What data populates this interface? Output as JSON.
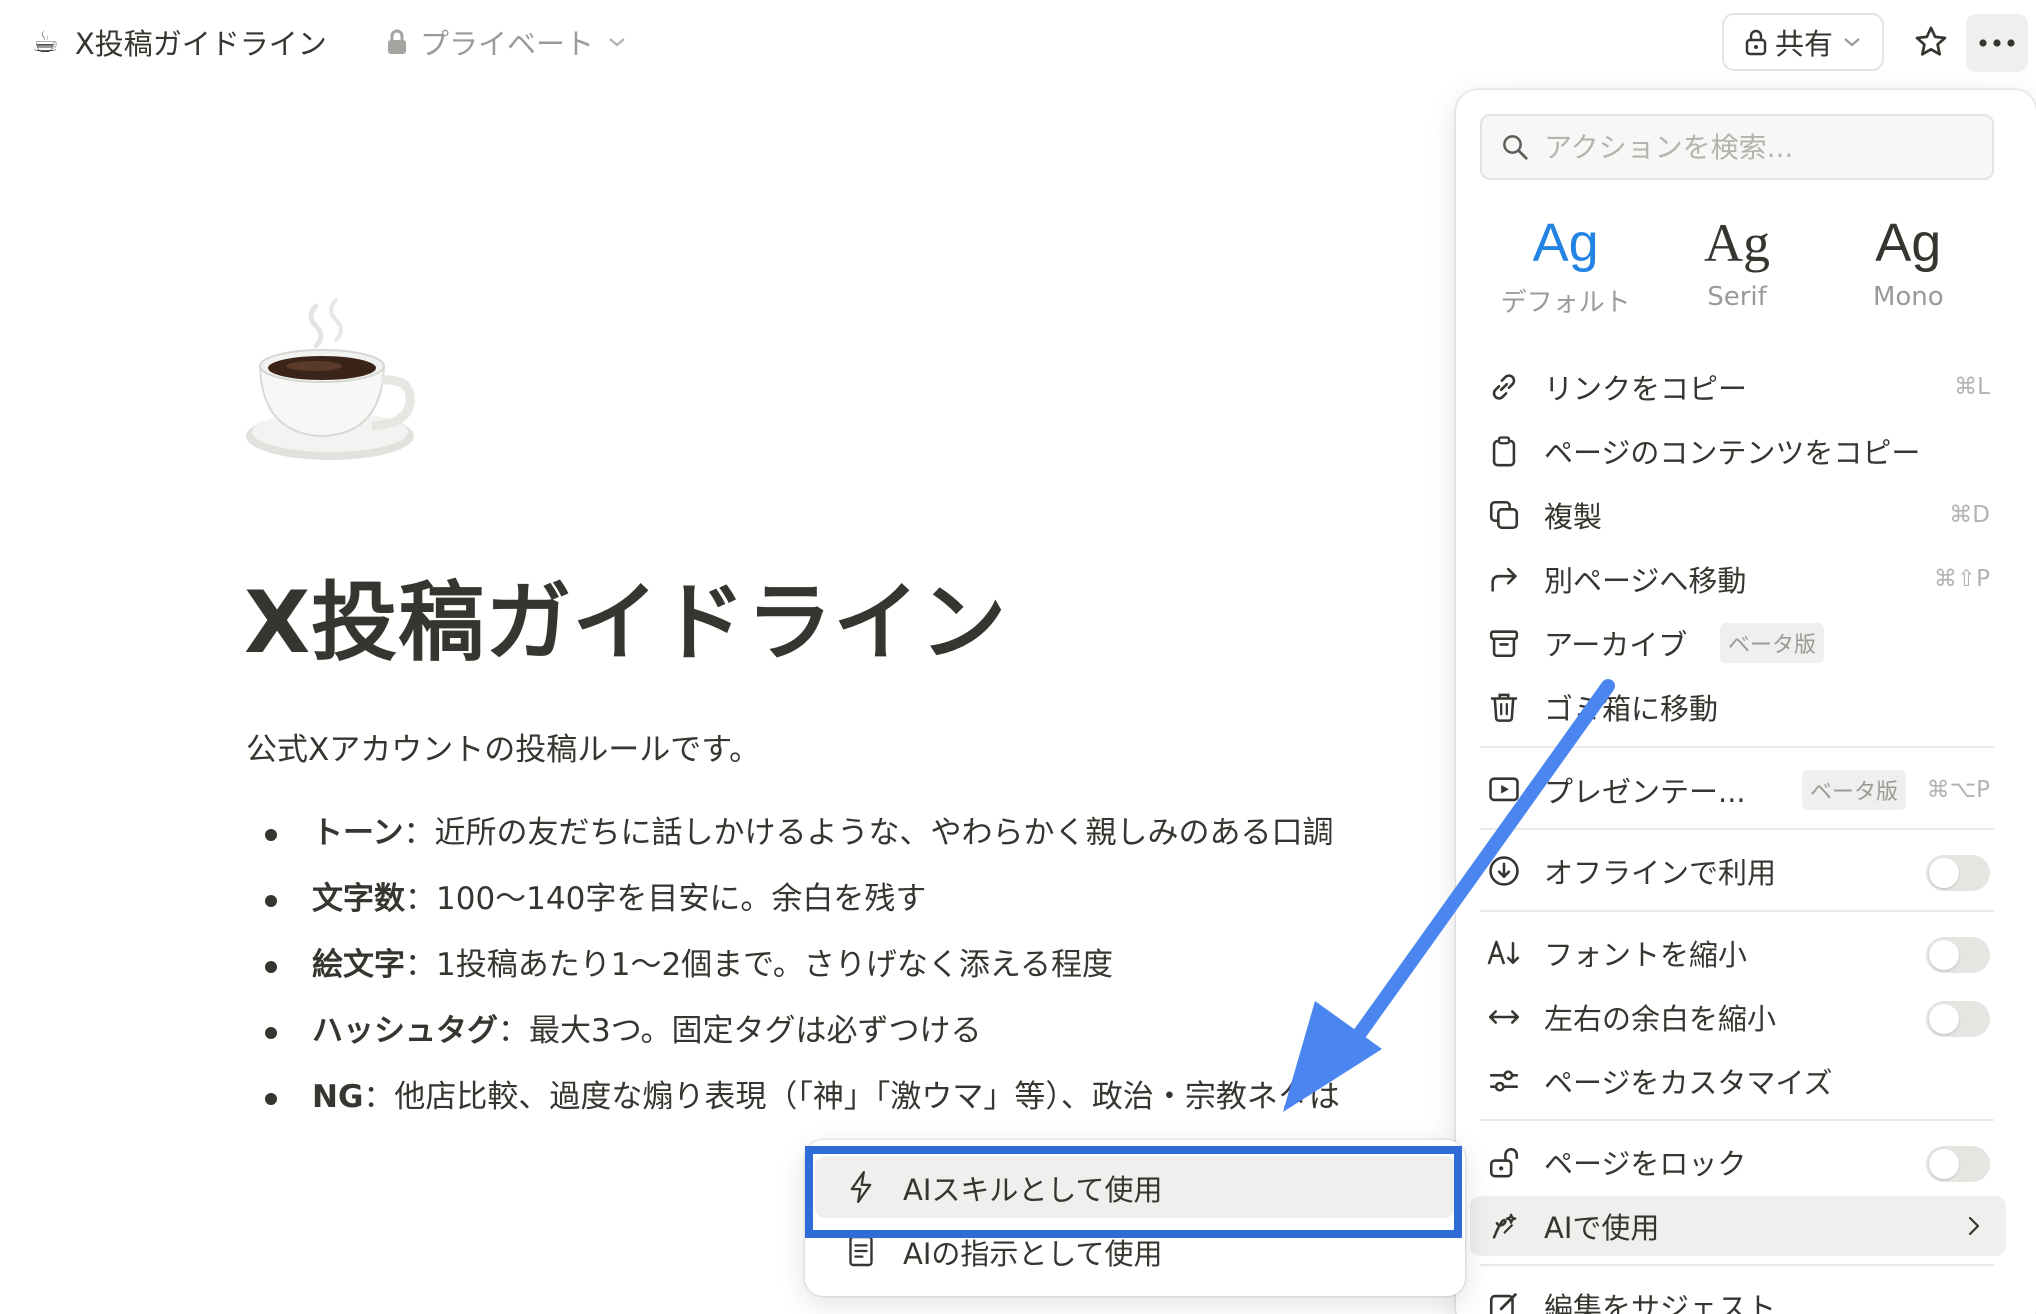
{
  "topbar": {
    "page_emoji": "☕",
    "page_title": "X投稿ガイドライン",
    "privacy_label": "プライベート",
    "share_label": "共有"
  },
  "page": {
    "title": "X投稿ガイドライン",
    "intro": "公式Xアカウントの投稿ルールです。",
    "bullets": [
      {
        "term": "トーン",
        "text": "：近所の友だちに話しかけるような、やわらかく親しみのある口調"
      },
      {
        "term": "文字数",
        "text": "：100〜140字を目安に。余白を残す"
      },
      {
        "term": "絵文字",
        "text": "：1投稿あたり1〜2個まで。さりげなく添える程度"
      },
      {
        "term": "ハッシュタグ",
        "text": "：最大3つ。固定タグは必ずつける"
      },
      {
        "term": "NG",
        "text": "：他店比較、過度な煽り表現（「神」「激ウマ」等）、政治・宗教ネタは"
      }
    ]
  },
  "menu": {
    "search_placeholder": "アクションを検索...",
    "fonts": [
      {
        "sample": "Ag",
        "label": "デフォルト",
        "active": true
      },
      {
        "sample": "Ag",
        "label": "Serif",
        "active": false
      },
      {
        "sample": "Ag",
        "label": "Mono",
        "active": false
      }
    ],
    "items": {
      "copy_link": {
        "label": "リンクをコピー",
        "shortcut": "⌘L",
        "icon": "link-icon"
      },
      "copy_contents": {
        "label": "ページのコンテンツをコピー",
        "icon": "clipboard-icon"
      },
      "duplicate": {
        "label": "複製",
        "shortcut": "⌘D",
        "icon": "duplicate-icon"
      },
      "move_to": {
        "label": "別ページへ移動",
        "shortcut": "⌘⇧P",
        "icon": "move-arrow-icon"
      },
      "archive": {
        "label": "アーカイブ",
        "badge": "ベータ版",
        "icon": "archive-icon"
      },
      "trash": {
        "label": "ゴミ箱に移動",
        "icon": "trash-icon"
      },
      "present": {
        "label": "プレゼンテー...",
        "badge": "ベータ版",
        "shortcut": "⌘⌥P",
        "icon": "present-icon"
      },
      "offline": {
        "label": "オフラインで利用",
        "toggle": false,
        "icon": "download-icon"
      },
      "small_text": {
        "label": "フォントを縮小",
        "toggle": false,
        "icon": "font-shrink-icon"
      },
      "full_width": {
        "label": "左右の余白を縮小",
        "toggle": false,
        "icon": "width-arrows-icon"
      },
      "customize": {
        "label": "ページをカスタマイズ",
        "icon": "sliders-icon"
      },
      "lock": {
        "label": "ページをロック",
        "toggle": false,
        "icon": "unlock-icon"
      },
      "use_with_ai": {
        "label": "AIで使用",
        "icon": "ai-icon"
      },
      "suggest_edits": {
        "label": "編集をサジェスト",
        "icon": "edit-icon"
      }
    }
  },
  "submenu": {
    "items": [
      {
        "label": "AIスキルとして使用",
        "icon": "lightning-icon",
        "highlighted": true
      },
      {
        "label": "AIの指示として使用",
        "icon": "document-icon",
        "highlighted": false
      }
    ]
  },
  "colors": {
    "accent": "#2383e2",
    "annotation_blue": "#2f6cd8",
    "text": "#37352f",
    "muted": "#9b9a97"
  }
}
